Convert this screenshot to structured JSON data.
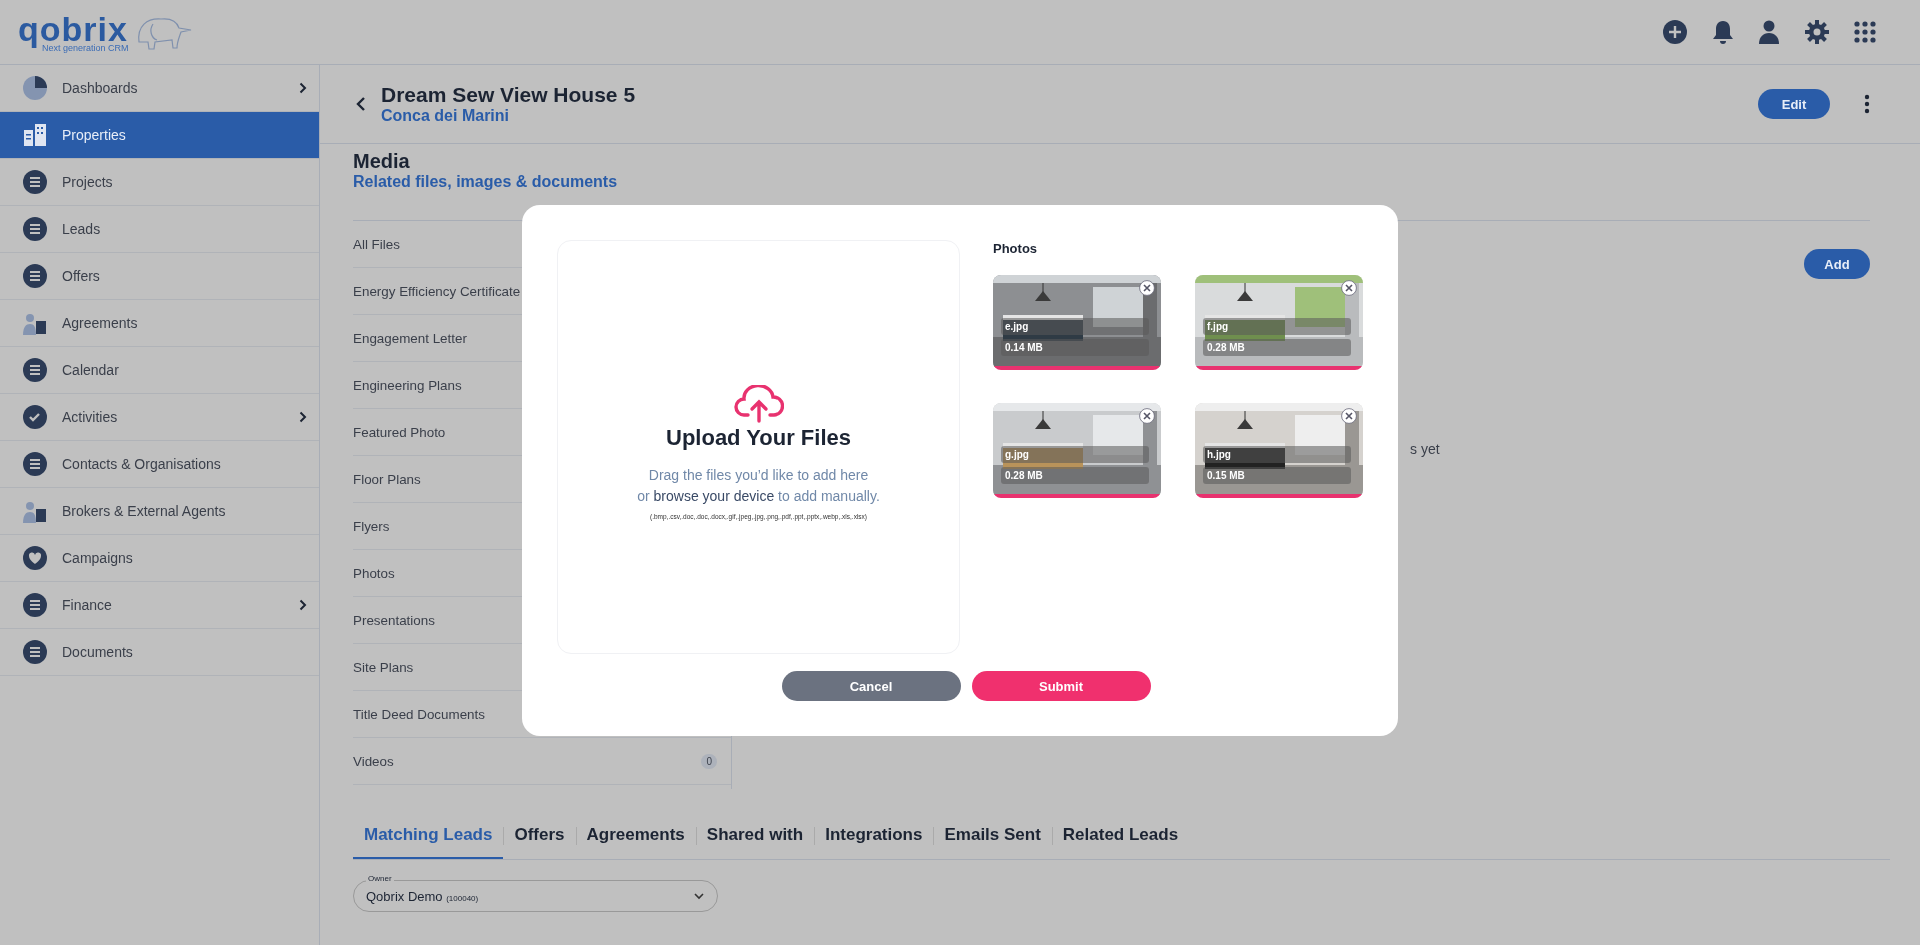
{
  "header": {
    "logo_name": "qobrix",
    "logo_tagline": "Next generation CRM"
  },
  "sidebar": {
    "items": [
      {
        "label": "Dashboards",
        "selected": false,
        "expandable": true
      },
      {
        "label": "Properties",
        "selected": true,
        "expandable": false
      },
      {
        "label": "Projects",
        "selected": false,
        "expandable": false
      },
      {
        "label": "Leads",
        "selected": false,
        "expandable": false
      },
      {
        "label": "Offers",
        "selected": false,
        "expandable": false
      },
      {
        "label": "Agreements",
        "selected": false,
        "expandable": false
      },
      {
        "label": "Calendar",
        "selected": false,
        "expandable": false
      },
      {
        "label": "Activities",
        "selected": false,
        "expandable": true
      },
      {
        "label": "Contacts & Organisations",
        "selected": false,
        "expandable": false
      },
      {
        "label": "Brokers & External Agents",
        "selected": false,
        "expandable": false
      },
      {
        "label": "Campaigns",
        "selected": false,
        "expandable": false
      },
      {
        "label": "Finance",
        "selected": false,
        "expandable": true
      },
      {
        "label": "Documents",
        "selected": false,
        "expandable": false
      }
    ]
  },
  "record": {
    "title": "Dream Sew View House 5",
    "subtitle": "Conca dei Marini",
    "edit_button": "Edit"
  },
  "media": {
    "title": "Media",
    "subtitle": "Related files, images & documents",
    "add_button": "Add",
    "empty_text": "s yet",
    "categories": [
      {
        "label": "All Files"
      },
      {
        "label": "Energy Efficiency Certificate"
      },
      {
        "label": "Engagement Letter"
      },
      {
        "label": "Engineering Plans"
      },
      {
        "label": "Featured Photo"
      },
      {
        "label": "Floor Plans"
      },
      {
        "label": "Flyers"
      },
      {
        "label": "Photos"
      },
      {
        "label": "Presentations"
      },
      {
        "label": "Site Plans"
      },
      {
        "label": "Title Deed Documents"
      },
      {
        "label": "Videos",
        "count": "0"
      }
    ]
  },
  "modal": {
    "drop_zone": {
      "title": "Upload Your Files",
      "line1": "Drag the files you’d like to add here",
      "line2_before": "or ",
      "link": "browse your device",
      "line2_after": " to add manually.",
      "formats": "(.bmp,.csv,.doc,.doc,.docx,.gif,.jpeg,.jpg,.png,.pdf,.ppt,.pptx,.webp,.xls,.xlsx)"
    },
    "photos_title": "Photos",
    "photos": [
      {
        "name": "e.jpg",
        "size": "0.14 MB",
        "level": 1
      },
      {
        "name": "f.jpg",
        "size": "0.28 MB",
        "level": 1
      },
      {
        "name": "g.jpg",
        "size": "0.28 MB",
        "level": 1
      },
      {
        "name": "h.jpg",
        "size": "0.15 MB",
        "level": 1
      }
    ],
    "cancel_button": "Cancel",
    "submit_button": "Submit"
  },
  "tabs": [
    {
      "label": "Matching Leads",
      "selected": true
    },
    {
      "label": "Offers",
      "selected": false
    },
    {
      "label": "Agreements",
      "selected": false
    },
    {
      "label": "Shared with",
      "selected": false
    },
    {
      "label": "Integrations",
      "selected": false
    },
    {
      "label": "Emails Sent",
      "selected": false
    },
    {
      "label": "Related Leads",
      "selected": false
    }
  ],
  "owner_field": {
    "label": "Owner",
    "value": "Qobrix Demo",
    "code": "(100040)"
  }
}
